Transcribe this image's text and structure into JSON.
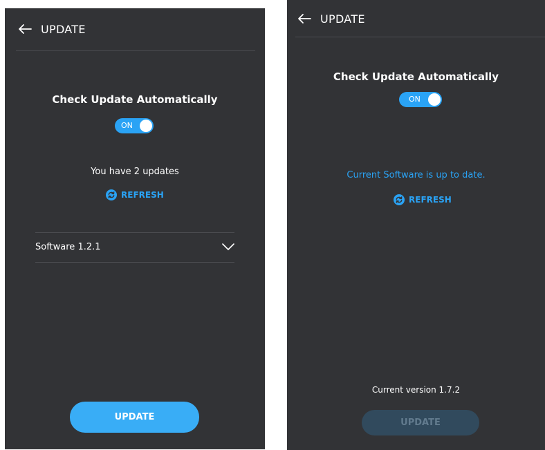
{
  "colors": {
    "panel_bg": "#323336",
    "accent": "#2aa3f5",
    "divider": "#4b4c50",
    "disabled_button_bg": "#314a5d",
    "disabled_button_text": "#627b8e"
  },
  "left_panel": {
    "header": {
      "title": "UPDATE",
      "back_icon": "arrow-left-icon"
    },
    "auto_update": {
      "title": "Check Update Automatically",
      "toggle_label": "ON",
      "enabled": true
    },
    "status": "You have 2 updates",
    "refresh": {
      "label": "REFRESH",
      "icon": "refresh-icon"
    },
    "software_item": {
      "label": "Software 1.2.1",
      "icon": "chevron-down-icon"
    },
    "update_button": {
      "label": "UPDATE",
      "enabled": true
    }
  },
  "right_panel": {
    "header": {
      "title": "UPDATE",
      "back_icon": "arrow-left-icon"
    },
    "auto_update": {
      "title": "Check Update Automatically",
      "toggle_label": "ON",
      "enabled": true
    },
    "status": "Current Software is up to date.",
    "refresh": {
      "label": "REFRESH",
      "icon": "refresh-icon"
    },
    "current_version": "Current version 1.7.2",
    "update_button": {
      "label": "UPDATE",
      "enabled": false
    }
  }
}
